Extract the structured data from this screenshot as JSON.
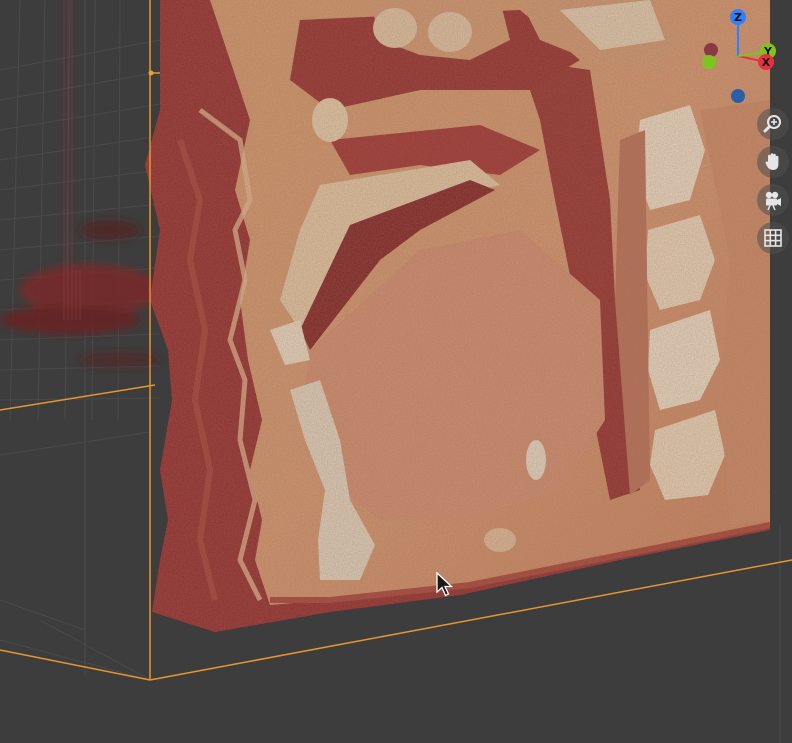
{
  "gizmo": {
    "z_label": "Z",
    "y_label": "Y",
    "x_label": "X",
    "colors": {
      "z": "#2f7fff",
      "y": "#7dc51e",
      "x": "#e8303f",
      "neg_x": "#8a3a45",
      "neg_y": "#6da22a",
      "neg_z": "#2a5fa8"
    }
  },
  "toolbar": {
    "items": [
      {
        "name": "zoom",
        "icon": "zoom-in-icon"
      },
      {
        "name": "pan",
        "icon": "hand-icon"
      },
      {
        "name": "camera",
        "icon": "camera-icon"
      },
      {
        "name": "grid",
        "icon": "grid-icon"
      }
    ]
  },
  "scene": {
    "background": "#3d3d3d",
    "grid_color": "#4a4a4a",
    "bounding_box_color": "#e8962e",
    "volume_color": "#c9956a"
  }
}
